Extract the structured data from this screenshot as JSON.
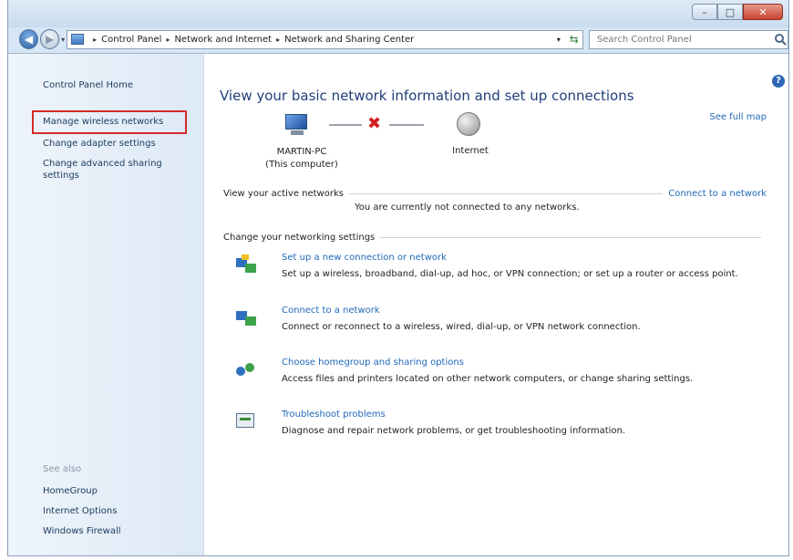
{
  "window": {
    "controls": {
      "minimize": "–",
      "maximize": "□",
      "close": "✕"
    }
  },
  "navigation": {
    "back_glyph": "◀",
    "forward_glyph": "▶",
    "dropdown_glyph": "▾",
    "breadcrumbs": [
      "Control Panel",
      "Network and Internet",
      "Network and Sharing Center"
    ],
    "separator": "▸",
    "search_placeholder": "Search Control Panel"
  },
  "sidebar": {
    "home": "Control Panel Home",
    "links": [
      "Manage wireless networks",
      "Change adapter settings",
      "Change advanced sharing",
      "settings"
    ],
    "see_also_title": "See also",
    "see_also_links": [
      "HomeGroup",
      "Internet Options",
      "Windows Firewall"
    ]
  },
  "main": {
    "help_glyph": "?",
    "heading": "View your basic network information and set up connections",
    "see_full_map": "See full map",
    "computer_name": "MARTIN-PC",
    "computer_sub": "(This computer)",
    "internet_label": "Internet",
    "active_networks_title": "View your active networks",
    "connect_link": "Connect to a network",
    "not_connected_text": "You are currently not connected to any networks.",
    "settings_title": "Change your networking settings",
    "tasks": [
      {
        "icon": "network-setup-icon",
        "link": "Set up a new connection or network",
        "desc": "Set up a wireless, broadband, dial-up, ad hoc, or VPN connection; or set up a router or access point."
      },
      {
        "icon": "connect-network-icon",
        "link": "Connect to a network",
        "desc": "Connect or reconnect to a wireless, wired, dial-up, or VPN network connection."
      },
      {
        "icon": "homegroup-icon",
        "link": "Choose homegroup and sharing options",
        "desc": "Access files and printers located on other network computers, or change sharing settings."
      },
      {
        "icon": "troubleshoot-icon",
        "link": "Troubleshoot problems",
        "desc": "Diagnose and repair network problems, or get troubleshooting information."
      }
    ]
  },
  "colors": {
    "link": "#1f68b9",
    "heading": "#1e3f7a",
    "highlight_box": "#d42a2a"
  }
}
